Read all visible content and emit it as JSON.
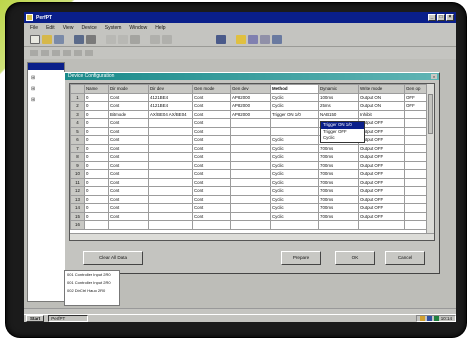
{
  "window": {
    "title": "PerfPT"
  },
  "menu": [
    "File",
    "Edit",
    "View",
    "Device",
    "System",
    "Window",
    "Help"
  ],
  "dialog": {
    "title": "Device Configuration"
  },
  "table": {
    "columns": [
      "",
      "Name",
      "Dir mode",
      "Dir dev",
      "Gen mode",
      "Gen dev",
      "Method",
      "Dynamic",
      "Write mode",
      "Gen op"
    ],
    "rows": [
      [
        "1",
        "0",
        "Cont",
        "4121BE4",
        "Cont",
        "AP82000",
        "Cyclic",
        "100ms",
        "Output ON",
        "OFF"
      ],
      [
        "2",
        "0",
        "Cont",
        "4121BE4",
        "Cont",
        "AP82000",
        "Cyclic",
        "25ms",
        "Output ON",
        "OFF"
      ],
      [
        "3",
        "0",
        "Bitmode",
        "AX/BE04 AX/BE04",
        "Cont",
        "AP82000",
        "Trigger ON 1/0",
        "NAB150",
        "Inhibit",
        ""
      ],
      [
        "4",
        "0",
        "Cont",
        "",
        "Cont",
        "",
        "",
        "700ms",
        "Output OFF",
        ""
      ],
      [
        "5",
        "0",
        "Cont",
        "",
        "Cont",
        "",
        "",
        "700ms",
        "Output OFF",
        ""
      ],
      [
        "6",
        "0",
        "Cont",
        "",
        "Cont",
        "",
        "Cyclic",
        "700ms",
        "Output OFF",
        ""
      ],
      [
        "7",
        "0",
        "Cont",
        "",
        "Cont",
        "",
        "Cyclic",
        "700ms",
        "Output OFF",
        ""
      ],
      [
        "8",
        "0",
        "Cont",
        "",
        "Cont",
        "",
        "Cyclic",
        "700ms",
        "Output OFF",
        ""
      ],
      [
        "9",
        "0",
        "Cont",
        "",
        "Cont",
        "",
        "Cyclic",
        "700ms",
        "Output OFF",
        ""
      ],
      [
        "10",
        "0",
        "Cont",
        "",
        "Cont",
        "",
        "Cyclic",
        "700ms",
        "Output OFF",
        ""
      ],
      [
        "11",
        "0",
        "Cont",
        "",
        "Cont",
        "",
        "Cyclic",
        "700ms",
        "Output OFF",
        ""
      ],
      [
        "12",
        "0",
        "Cont",
        "",
        "Cont",
        "",
        "Cyclic",
        "700ms",
        "Output OFF",
        ""
      ],
      [
        "13",
        "0",
        "Cont",
        "",
        "Cont",
        "",
        "Cyclic",
        "700ms",
        "Output OFF",
        ""
      ],
      [
        "14",
        "0",
        "Cont",
        "",
        "Cont",
        "",
        "Cyclic",
        "700ms",
        "Output OFF",
        ""
      ],
      [
        "15",
        "0",
        "Cont",
        "",
        "Cont",
        "",
        "Cyclic",
        "700ms",
        "Output OFF",
        ""
      ],
      [
        "16",
        "",
        "",
        "",
        "",
        "",
        "",
        "",
        "",
        ""
      ]
    ]
  },
  "method_dropdown": {
    "options": [
      "Trigger ON 1/0",
      "Trigger OFF",
      "Cyclic"
    ],
    "selected_index": 0
  },
  "buttons": {
    "clear_all": "Clear All Data",
    "prepare": "Prepare",
    "ok": "OK",
    "cancel": "Cancel"
  },
  "lower_list": [
    "001 Controller Input 2R0",
    "001 Controller Input 2R0",
    "002 DirCtrl Hauo 2R0"
  ],
  "taskbar": {
    "start": "Start",
    "task": "PerfPT",
    "clock": "10:14"
  },
  "colors": {
    "titlebar": "#0a1f8a",
    "dialog_title": "#198a8a",
    "selection": "#0a1f8a",
    "lime_accent": "#bcd64a"
  }
}
